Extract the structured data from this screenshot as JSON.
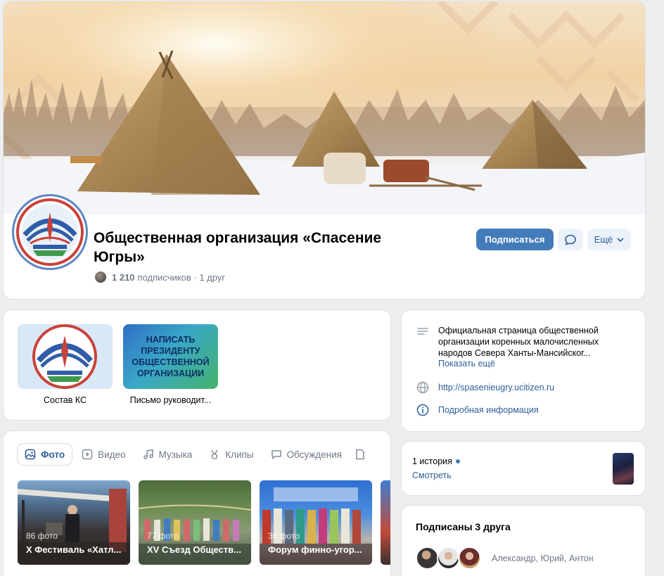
{
  "header": {
    "title": "Общественная организация «Спасение Югры»",
    "subscribers_count": "1 210",
    "subscribers_label": "подписчиков · 1 друг",
    "subscribe_label": "Подписаться",
    "more_label": "Ещё"
  },
  "links": [
    {
      "label": "Состав КС"
    },
    {
      "label": "Письмо руководит...",
      "thumb_text": "НАПИСАТЬ ПРЕЗИДЕНТУ ОБЩЕСТВЕННОЙ ОРГАНИЗАЦИИ"
    }
  ],
  "tabs": [
    {
      "label": "Фото",
      "icon": "image-icon",
      "active": true
    },
    {
      "label": "Видео",
      "icon": "video-icon"
    },
    {
      "label": "Музыка",
      "icon": "music-icon"
    },
    {
      "label": "Клипы",
      "icon": "clips-icon"
    },
    {
      "label": "Обсуждения",
      "icon": "discussion-icon"
    }
  ],
  "albums": [
    {
      "count": "86 фото",
      "name": "X Фестиваль «Хатл..."
    },
    {
      "count": "77 фото",
      "name": "XV Съезд Обществ..."
    },
    {
      "count": "30 фото",
      "name": "Форум финно-угор..."
    }
  ],
  "info": {
    "description": "Официальная страница общественной организации коренных малочисленных народов Севера Ханты-Мансийског...",
    "show_more": "Показать ещё",
    "website": "http://spasenieugry.ucitizen.ru",
    "details": "Подробная информация"
  },
  "stories": {
    "count": "1 история",
    "watch": "Смотреть"
  },
  "friends": {
    "title": "Подписаны 3 друга",
    "names": "Александр, Юрий, Антон"
  },
  "colors": {
    "accent": "#447bba",
    "link": "#2c5d9a",
    "background": "#edeef0"
  }
}
